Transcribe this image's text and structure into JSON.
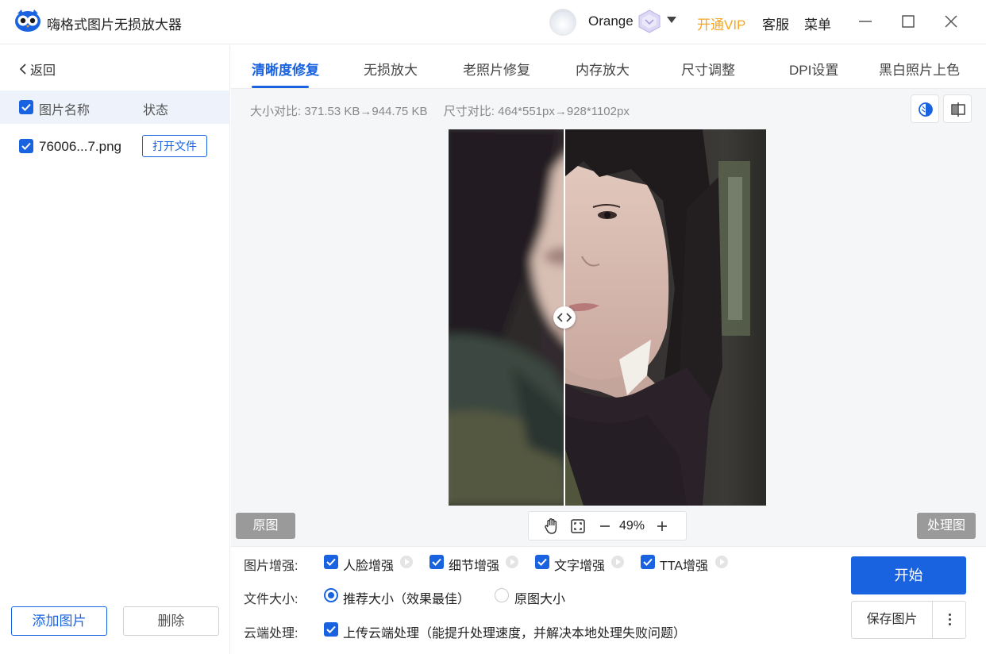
{
  "app": {
    "title": "嗨格式图片无损放大器",
    "user_name": "Orange",
    "vip_label": "开通VIP",
    "service_label": "客服",
    "menu_label": "菜单"
  },
  "sidebar": {
    "back_label": "返回",
    "header_name": "图片名称",
    "header_status": "状态",
    "files": [
      {
        "name": "76006...7.png",
        "action": "打开文件",
        "checked": true
      }
    ],
    "add_label": "添加图片",
    "delete_label": "删除"
  },
  "tabs": [
    {
      "label": "清晰度修复",
      "active": true
    },
    {
      "label": "无损放大",
      "active": false
    },
    {
      "label": "老照片修复",
      "active": false
    },
    {
      "label": "内存放大",
      "active": false
    },
    {
      "label": "尺寸调整",
      "active": false
    },
    {
      "label": "DPI设置",
      "active": false
    },
    {
      "label": "黑白照片上色",
      "active": false
    }
  ],
  "preview": {
    "size_compare": "大小对比: 371.53 KB→944.75 KB",
    "dimension_compare": "尺寸对比: 464*551px→928*1102px",
    "original_label": "原图",
    "processed_label": "处理图",
    "zoom": "49%",
    "split_position": 0.365
  },
  "options": {
    "enhance_label": "图片增强:",
    "enhancements": [
      {
        "label": "人脸增强",
        "checked": true
      },
      {
        "label": "细节增强",
        "checked": true
      },
      {
        "label": "文字增强",
        "checked": true
      },
      {
        "label": "TTA增强",
        "checked": true
      }
    ],
    "filesize_label": "文件大小:",
    "filesize_options": [
      {
        "label": "推荐大小（效果最佳）",
        "selected": true
      },
      {
        "label": "原图大小",
        "selected": false
      }
    ],
    "cloud_label": "云端处理:",
    "cloud_option": "上传云端处理（能提升处理速度，并解决本地处理失败问题）",
    "cloud_checked": true,
    "start_label": "开始",
    "save_label": "保存图片"
  },
  "colors": {
    "accent": "#1a63e0",
    "vip": "#f5a623"
  }
}
